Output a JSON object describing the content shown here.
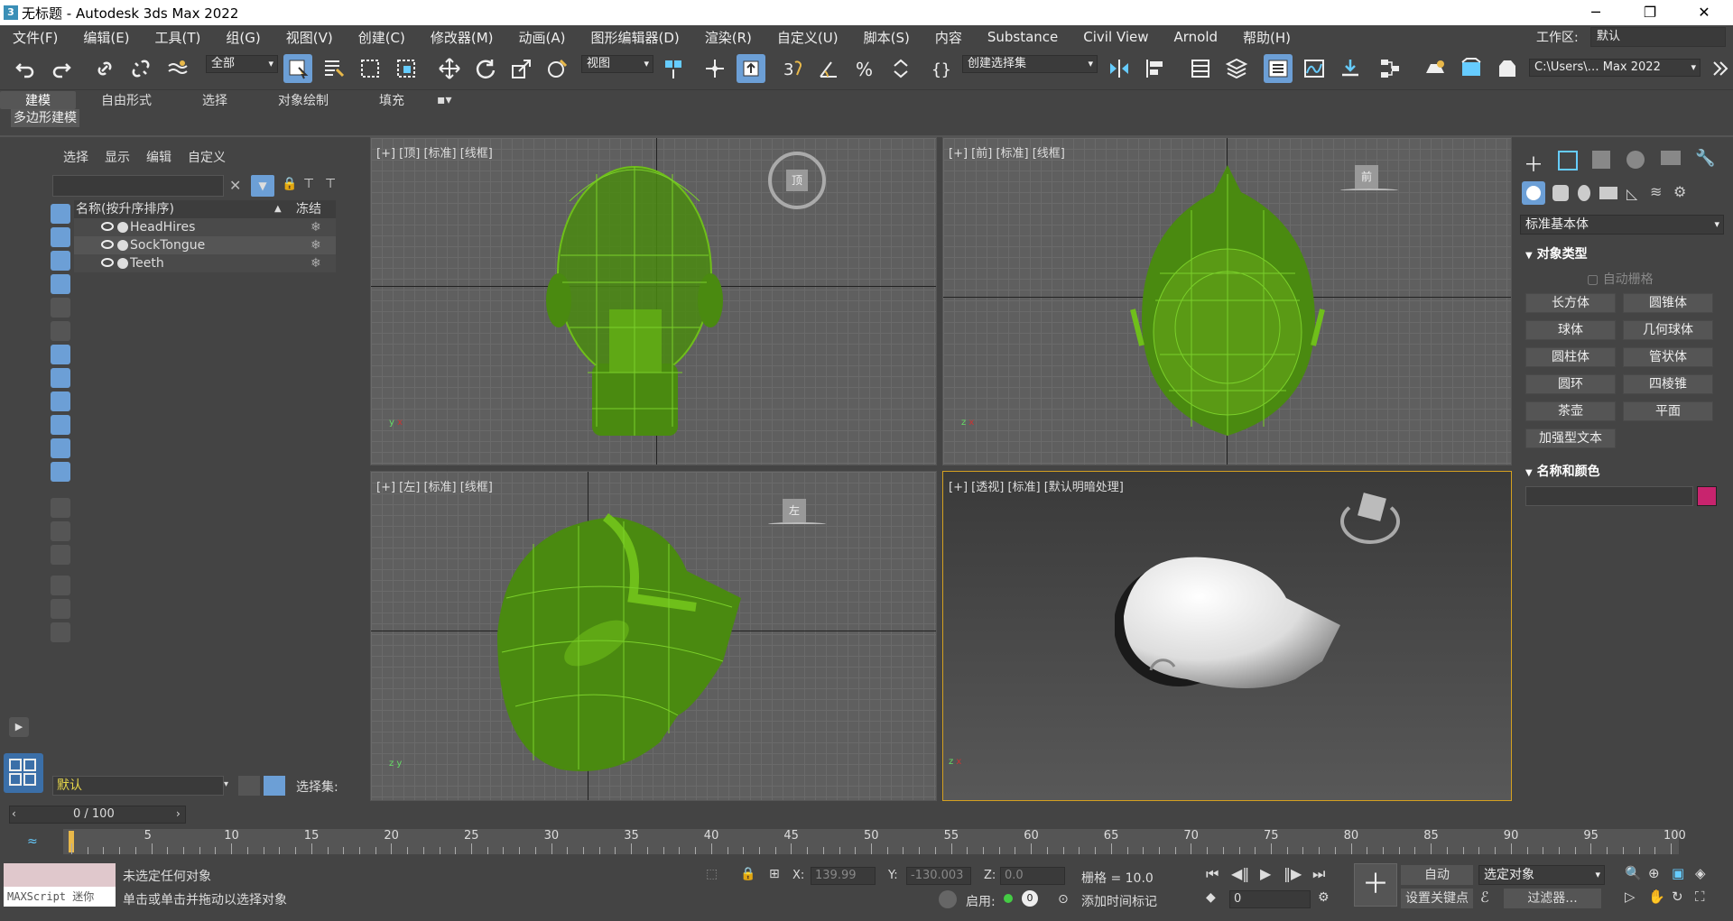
{
  "window": {
    "title": "无标题 - Autodesk 3ds Max 2022",
    "app_icon": "3"
  },
  "menu": {
    "items": [
      "文件(F)",
      "编辑(E)",
      "工具(T)",
      "组(G)",
      "视图(V)",
      "创建(C)",
      "修改器(M)",
      "动画(A)",
      "图形编辑器(D)",
      "渲染(R)",
      "自定义(U)",
      "脚本(S)",
      "内容",
      "Substance",
      "Civil View",
      "Arnold",
      "帮助(H)"
    ],
    "workspace_label": "工作区:",
    "workspace_value": "默认"
  },
  "toolbar": {
    "selection_filter": "全部",
    "ref_coord": "视图",
    "named_selection": "创建选择集",
    "path": "C:\\Users\\… Max 2022"
  },
  "ribbon": {
    "tabs": [
      "建模",
      "自由形式",
      "选择",
      "对象绘制",
      "填充"
    ],
    "active_tab": "建模",
    "sub": "多边形建模"
  },
  "explorer": {
    "tabs": [
      "选择",
      "显示",
      "编辑",
      "自定义"
    ],
    "col_name": "名称(按升序排序)",
    "col_sort": "▲",
    "col_frozen": "冻结",
    "objects": [
      "HeadHires",
      "SockTongue",
      "Teeth"
    ],
    "layer": "默认",
    "selection_set_label": "选择集:"
  },
  "viewports": {
    "top": "[+] [顶] [标准] [线框]",
    "front": "[+] [前] [标准] [线框]",
    "left": "[+] [左] [标准] [线框]",
    "persp": "[+] [透视] [标准] [默认明暗处理]",
    "cube_top": "顶",
    "cube_front": "前",
    "cube_left": "左"
  },
  "command_panel": {
    "category": "标准基本体",
    "object_type": "对象类型",
    "autogrid": "自动栅格",
    "buttons": [
      "长方体",
      "圆锥体",
      "球体",
      "几何球体",
      "圆柱体",
      "管状体",
      "圆环",
      "四棱锥",
      "茶壶",
      "平面",
      "加强型文本"
    ],
    "name_color": "名称和颜色",
    "color": "#c8246e"
  },
  "timeline": {
    "frame": "0 / 100",
    "ticks": [
      "5",
      "10",
      "15",
      "20",
      "25",
      "30",
      "35",
      "40",
      "45",
      "50",
      "55",
      "60",
      "65",
      "70",
      "75",
      "80",
      "85",
      "90",
      "95",
      "100"
    ]
  },
  "status": {
    "maxscript": "MAXScript 迷你",
    "line1": "未选定任何对象",
    "line2": "单击或单击并拖动以选择对象",
    "x_label": "X:",
    "x": "139.99",
    "y_label": "Y:",
    "y": "-130.003",
    "z_label": "Z:",
    "z": "0.0",
    "grid": "栅格 = 10.0",
    "enable": "启用:",
    "enable_count": "0",
    "add_time_tag": "添加时间标记",
    "auto": "自动",
    "selected": "选定对象",
    "set_key": "设置关键点",
    "filters": "过滤器...",
    "frame_field": "0"
  }
}
